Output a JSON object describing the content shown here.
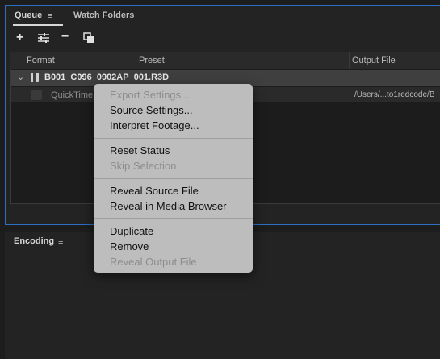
{
  "queue": {
    "tabs": {
      "queue": "Queue",
      "watch_folders": "Watch Folders"
    },
    "menu_glyph": "≡",
    "toolbar": {
      "add": "+",
      "settings": "⚟",
      "remove": "−",
      "duplicate": "⧉"
    },
    "columns": {
      "format": "Format",
      "preset": "Preset",
      "output": "Output File"
    },
    "item": {
      "name": "B001_C096_0902AP_001.R3D"
    },
    "subitem": {
      "format": "QuickTime",
      "output": "/Users/...to1redcode/B"
    }
  },
  "encoding": {
    "title": "Encoding",
    "menu_glyph": "≡"
  },
  "context_menu": {
    "export_settings": "Export Settings...",
    "source_settings": "Source Settings...",
    "interpret_footage": "Interpret Footage...",
    "reset_status": "Reset Status",
    "skip_selection": "Skip Selection",
    "reveal_source": "Reveal Source File",
    "reveal_media_browser": "Reveal in Media Browser",
    "duplicate": "Duplicate",
    "remove": "Remove",
    "reveal_output": "Reveal Output File"
  }
}
